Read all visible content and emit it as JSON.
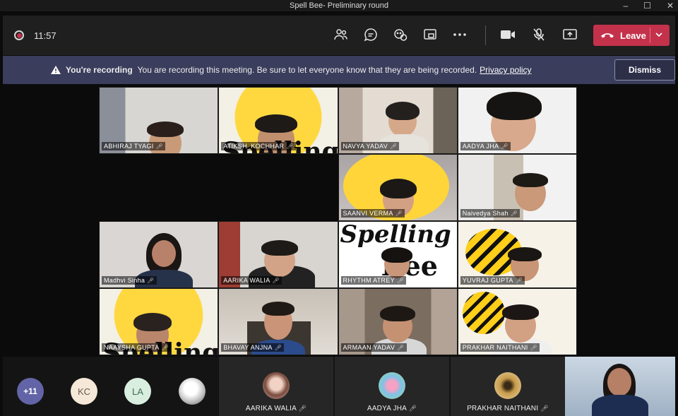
{
  "window": {
    "title": "Spell Bee- Preliminary round",
    "controls": [
      "–",
      "☐",
      "✕"
    ]
  },
  "toolbar": {
    "timer": "11:57",
    "icons": [
      "people-icon",
      "chat-icon",
      "reactions-icon",
      "share-tray-icon",
      "more-icon"
    ],
    "camera_icon": "camera-icon",
    "mic_icon": "mic-off-icon",
    "share_icon": "share-screen-icon",
    "leave_label": "Leave",
    "leave_color": "#c4314b"
  },
  "banner": {
    "title": "You're recording",
    "message": "You are recording this meeting. Be sure to let everyone know that they are being recorded.",
    "link": "Privacy policy",
    "dismiss": "Dismiss",
    "background": "#3a3d5c"
  },
  "tiles": [
    {
      "name": "ABHIRAJ TYAGI"
    },
    {
      "name": "ATIKSH_KOCHHAR"
    },
    {
      "name": "NAVYA YADAV"
    },
    {
      "name": "AADYA JHA"
    },
    {
      "name": "SAANVI VERMA"
    },
    {
      "name": "Naivedya Shah"
    },
    {
      "name": "Madhvi Sinha"
    },
    {
      "name": "AARIKA WALIA"
    },
    {
      "name": "RHYTHM ATREY"
    },
    {
      "name": "YUVRAJ GUPTA"
    },
    {
      "name": "NAAYSHA GUPTA"
    },
    {
      "name": "BHAVAY ANJNA"
    },
    {
      "name": "ARMAAN YADAV"
    },
    {
      "name": "PRAKHAR NAITHANI"
    }
  ],
  "overlay_text": {
    "spelling": "Spelling",
    "bee": "Bee"
  },
  "bottom": {
    "more_count": "+11",
    "avatars": [
      "KC",
      "LA"
    ],
    "cards": [
      {
        "name": "AARIKA WALIA"
      },
      {
        "name": "AADYA JHA"
      },
      {
        "name": "PRAKHAR NAITHANI"
      }
    ]
  }
}
